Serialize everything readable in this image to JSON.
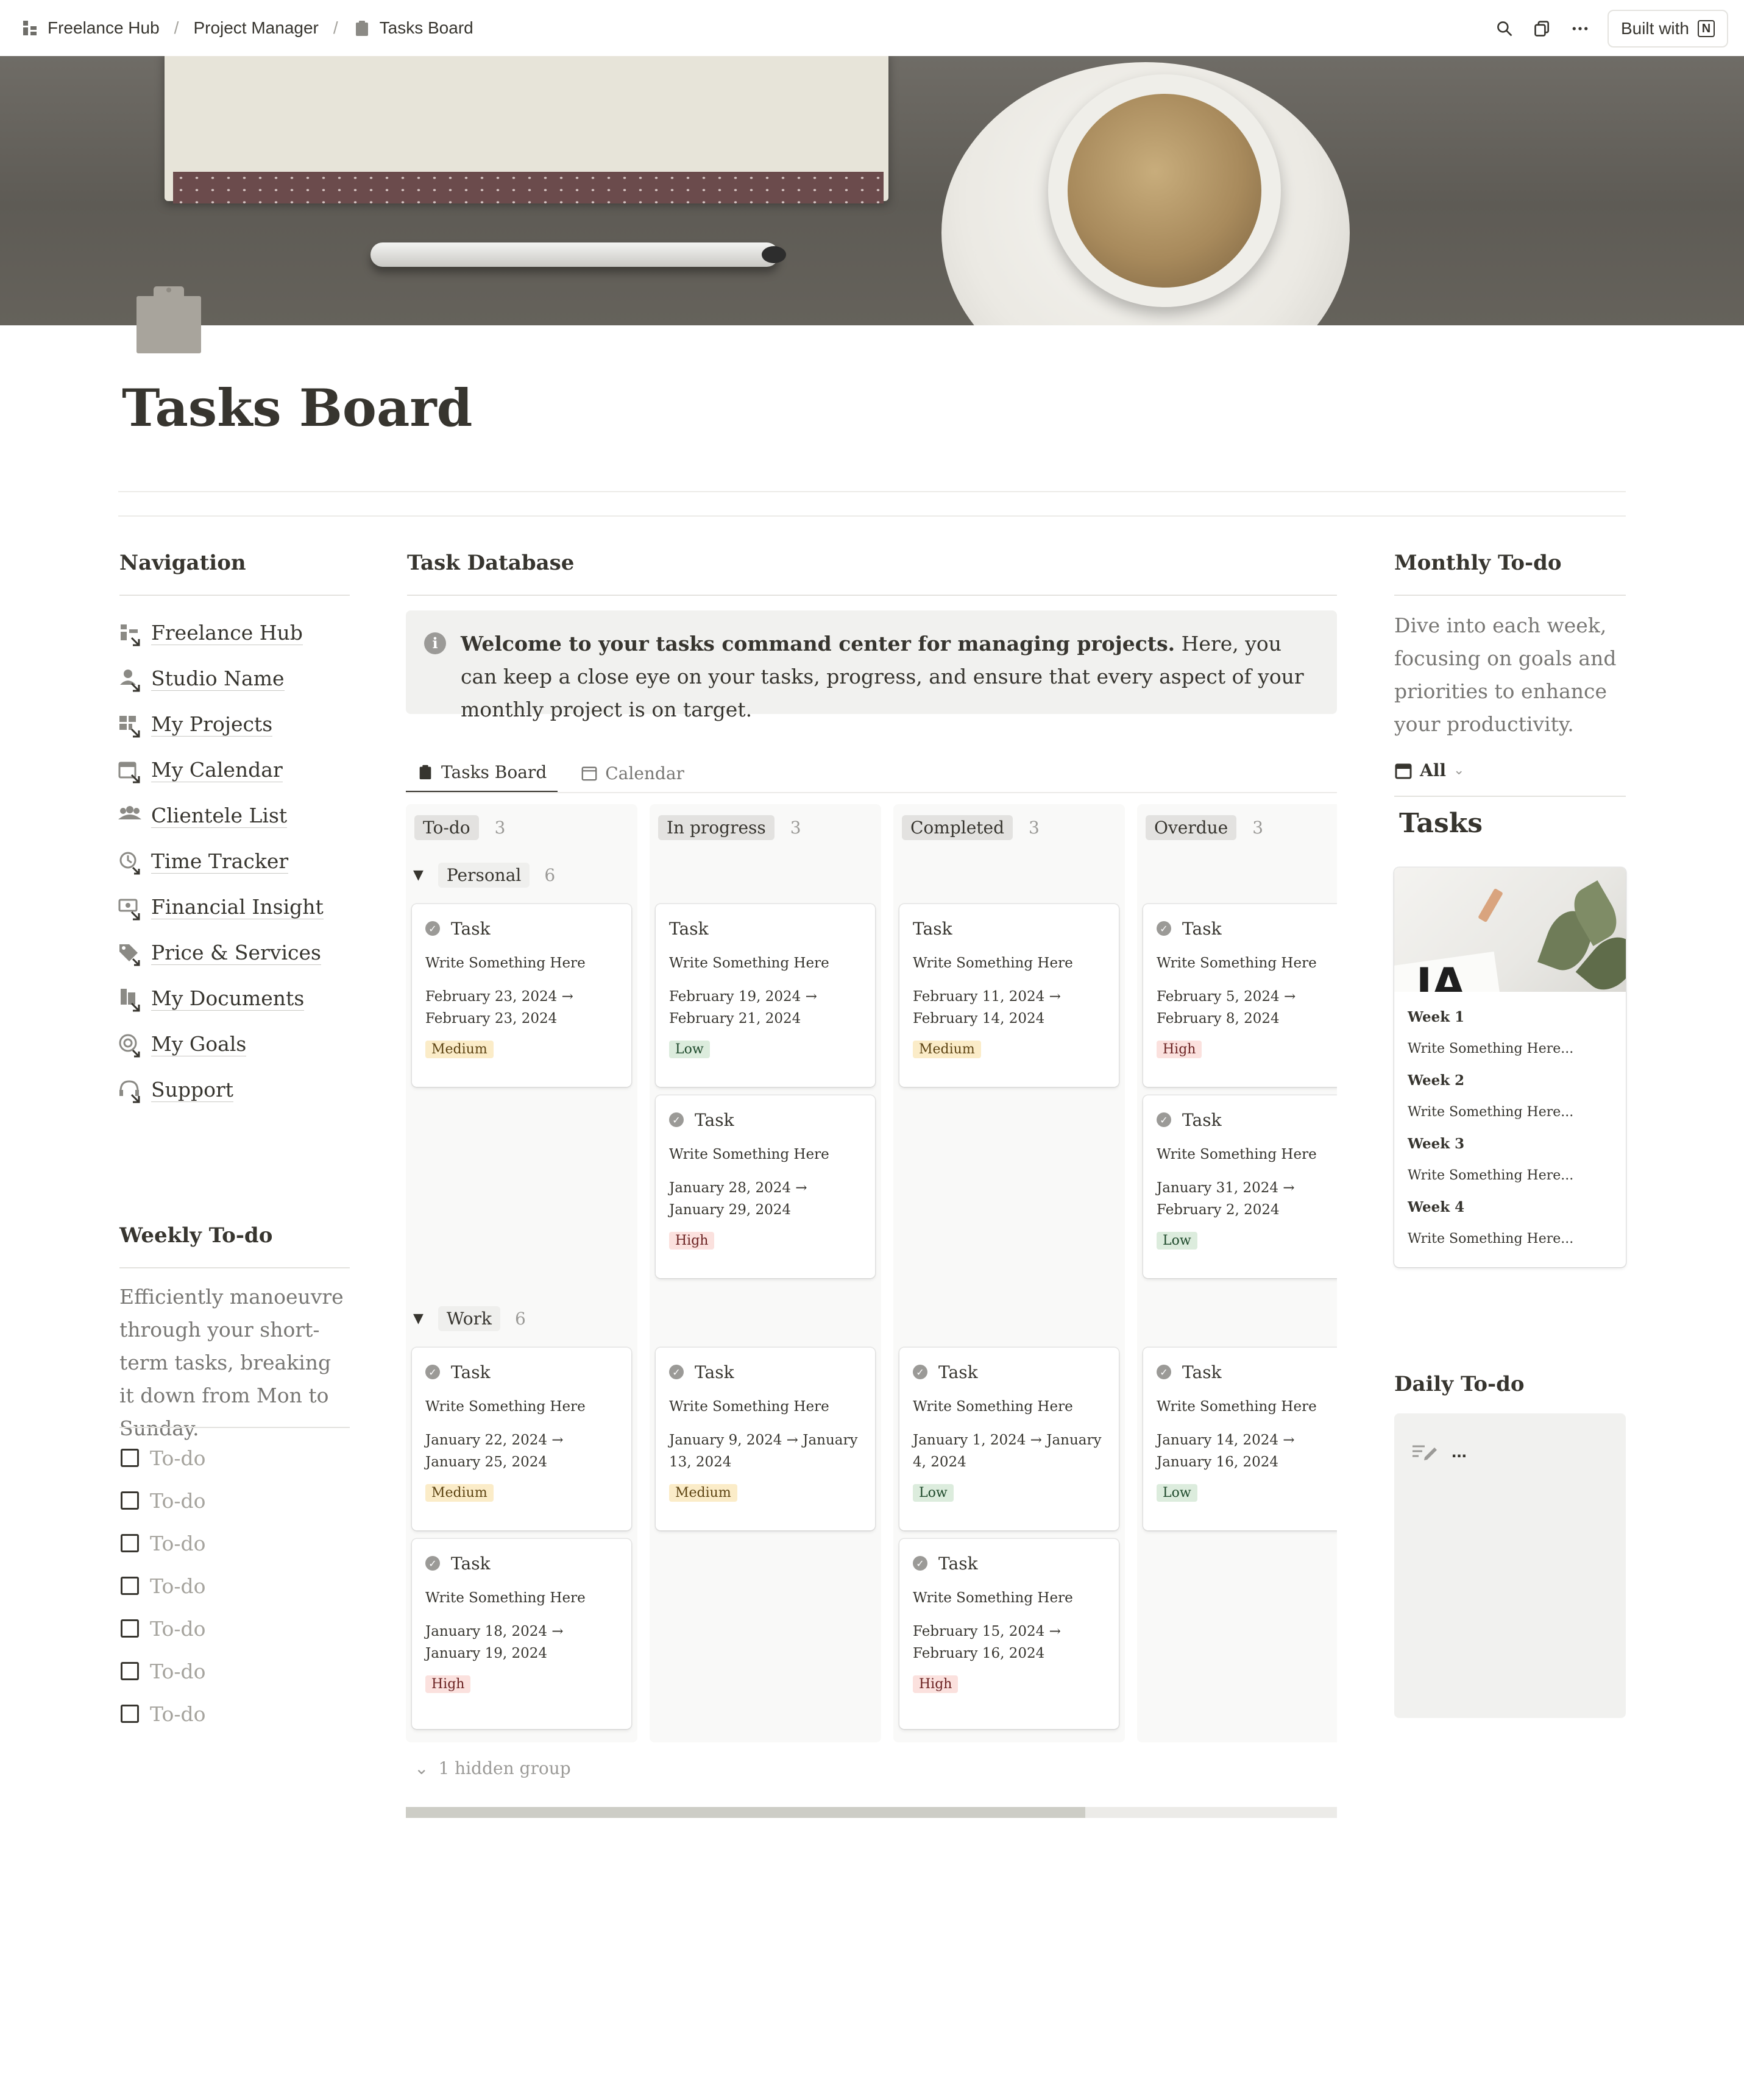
{
  "breadcrumb": {
    "items": [
      "Freelance Hub",
      "Project Manager",
      "Tasks Board"
    ]
  },
  "topbar": {
    "built_with": "Built with"
  },
  "page": {
    "title": "Tasks Board"
  },
  "navigation": {
    "heading": "Navigation",
    "items": [
      {
        "label": "Freelance Hub",
        "icon": "hub-icon"
      },
      {
        "label": "Studio Name",
        "icon": "person-icon"
      },
      {
        "label": "My Projects",
        "icon": "dashboard-icon"
      },
      {
        "label": "My Calendar",
        "icon": "calendar-icon"
      },
      {
        "label": "Clientele List",
        "icon": "people-icon"
      },
      {
        "label": "Time Tracker",
        "icon": "clock-icon"
      },
      {
        "label": "Financial Insight",
        "icon": "money-icon"
      },
      {
        "label": "Price & Services",
        "icon": "tag-icon"
      },
      {
        "label": "My Documents",
        "icon": "documents-icon"
      },
      {
        "label": "My Goals",
        "icon": "target-icon"
      },
      {
        "label": "Support",
        "icon": "headset-icon"
      }
    ]
  },
  "weekly": {
    "heading": "Weekly To-do",
    "description": "Efficiently manoeuvre through your short-term tasks, breaking it down from Mon to Sunday.",
    "todos": [
      "To-do",
      "To-do",
      "To-do",
      "To-do",
      "To-do",
      "To-do",
      "To-do"
    ]
  },
  "task_database": {
    "heading": "Task Database",
    "callout_bold": "Welcome to your tasks command center for managing projects.",
    "callout_rest": " Here, you can keep a close eye on your tasks, progress, and ensure that every aspect of your monthly project is on target.",
    "tabs": [
      {
        "label": "Tasks Board",
        "icon": "clipboard-icon"
      },
      {
        "label": "Calendar",
        "icon": "calendar-icon"
      }
    ],
    "statuses": [
      {
        "label": "To-do",
        "count": "3"
      },
      {
        "label": "In progress",
        "count": "3"
      },
      {
        "label": "Completed",
        "count": "3"
      },
      {
        "label": "Overdue",
        "count": "3"
      }
    ],
    "groups": [
      {
        "label": "Personal",
        "count": "6"
      },
      {
        "label": "Work",
        "count": "6"
      }
    ],
    "cards": {
      "personal_todo_1": {
        "title": "Task",
        "sub": "Write Something Here",
        "date": "February 23, 2024 → February 23, 2024",
        "priority": "Medium"
      },
      "personal_progress_1": {
        "title": "Task",
        "sub": "Write Something Here",
        "date": "February 19, 2024 → February 21, 2024",
        "priority": "Low"
      },
      "personal_progress_2": {
        "title": "Task",
        "sub": "Write Something Here",
        "date": "January 28, 2024 → January 29, 2024",
        "priority": "High"
      },
      "personal_completed_1": {
        "title": "Task",
        "sub": "Write Something Here",
        "date": "February 11, 2024 → February 14, 2024",
        "priority": "Medium"
      },
      "personal_overdue_1": {
        "title": "Task",
        "sub": "Write Something Here",
        "date": "February 5, 2024 → February 8, 2024",
        "priority": "High"
      },
      "personal_overdue_2": {
        "title": "Task",
        "sub": "Write Something Here",
        "date": "January 31, 2024 → February 2, 2024",
        "priority": "Low"
      },
      "work_todo_1": {
        "title": "Task",
        "sub": "Write Something Here",
        "date": "January 22, 2024 → January 25, 2024",
        "priority": "Medium"
      },
      "work_todo_2": {
        "title": "Task",
        "sub": "Write Something Here",
        "date": "January 18, 2024 → January 19, 2024",
        "priority": "High"
      },
      "work_progress_1": {
        "title": "Task",
        "sub": "Write Something Here",
        "date": "January 9, 2024 → January 13, 2024",
        "priority": "Medium"
      },
      "work_completed_1": {
        "title": "Task",
        "sub": "Write Something Here",
        "date": "January 1, 2024 → January 4, 2024",
        "priority": "Low"
      },
      "work_completed_2": {
        "title": "Task",
        "sub": "Write Something Here",
        "date": "February 15, 2024 → February 16, 2024",
        "priority": "High"
      },
      "work_overdue_1": {
        "title": "Task",
        "sub": "Write Something Here",
        "date": "January 14, 2024 → January 16, 2024",
        "priority": "Low"
      }
    },
    "hidden_groups": "1 hidden group",
    "scroll_position": 0.73
  },
  "monthly": {
    "heading": "Monthly To-do",
    "description": "Dive into each week, focusing on goals and priorities to enhance your productivity.",
    "filter": "All",
    "tasks_title": "Tasks",
    "weeks": [
      {
        "label": "Week 1",
        "sub": "Write Something Here..."
      },
      {
        "label": "Week 2",
        "sub": "Write Something Here..."
      },
      {
        "label": "Week 3",
        "sub": "Write Something Here..."
      },
      {
        "label": "Week 4",
        "sub": "Write Something Here..."
      }
    ]
  },
  "daily": {
    "heading": "Daily To-do",
    "placeholder": "..."
  },
  "colors": {
    "text": "#37352f",
    "muted": "#787774",
    "tag_medium": "#fbecc8",
    "tag_low": "#dcecdd",
    "tag_high": "#fbe1de",
    "callout_bg": "#f1f1ef"
  }
}
